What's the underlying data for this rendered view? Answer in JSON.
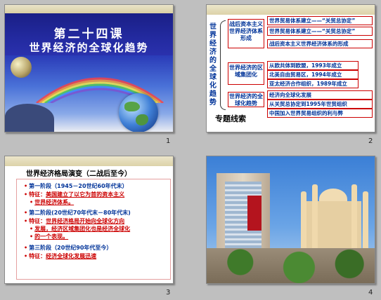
{
  "slides": [
    {
      "number": "1",
      "title_line1": "第二十四课",
      "title_line2": "世界经济的全球化趋势"
    },
    {
      "number": "2",
      "vertical_title": "世界经济的全球化趋势",
      "branches": [
        {
          "label": "战后资本主义世界经济体系形成",
          "items": [
            "世界贸易体系建立——“关贸总协定”",
            "战后资本主义世界经济体系的形成"
          ]
        },
        {
          "label": "世界经济的区域集团化",
          "items": [
            "从欧共体到欧盟，1993年成立",
            "北美自由贸易区，1994年成立",
            "亚太经济合作组织，1989年成立"
          ]
        },
        {
          "label": "世界经济的全球化趋势",
          "items": [
            "经济向全球化发展",
            "从关贸总协定到1995年世贸组织",
            "中国加入世界贸易组织的利与弊"
          ]
        }
      ],
      "footer": "专题线索"
    },
    {
      "number": "3",
      "heading": "世界经济格局演变（二战后至今）",
      "stages": [
        {
          "stage": "第一阶段（1945－20世纪60年代末）",
          "label": "特征：",
          "text1": "美国建立了以它为首的资本主义",
          "text2": "世界经济体系。"
        },
        {
          "stage": "第二阶段(20世纪70年代末－80年代末)",
          "label": "特征：",
          "text1": "世界经济格局开始向全球化方向",
          "text2": "发展，经济区域集团化也是经济全球化",
          "text3": "的一个表现。"
        },
        {
          "stage": "第三阶段（20世纪90年代至今）",
          "label": "特征：",
          "text1": "经济全球化发展迅速"
        }
      ]
    },
    {
      "number": "4"
    }
  ],
  "colors": {
    "text_blue": "#003399",
    "accent_red": "#cc0000",
    "frame_bg": "#bfbfbf"
  }
}
